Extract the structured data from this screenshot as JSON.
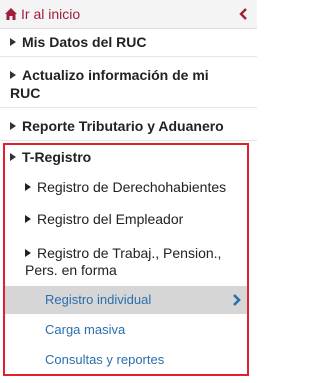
{
  "header": {
    "home_label": "Ir al inicio",
    "home_icon": "home-icon",
    "collapse_icon": "chevron-left-icon"
  },
  "menu": {
    "item_datos": "Mis Datos del RUC",
    "item_actualizo_line1": "Actualizo información de mi",
    "item_actualizo_line2": "RUC",
    "item_reporte": "Reporte Tributario y Aduanero",
    "item_tregistro": "T-Registro"
  },
  "tregistro": {
    "sub_derechohabientes": "Registro de Derechohabientes",
    "sub_empleador": "Registro del Empleador",
    "sub_trabaj_line1": "Registro de Trabaj., Pension.,",
    "sub_trabaj_line2": "Pers. en forma",
    "leaf_individual": "Registro individual",
    "leaf_masiva": "Carga masiva",
    "leaf_consultas": "Consultas y reportes"
  },
  "colors": {
    "brand": "#a01e3c",
    "link": "#2a6fad",
    "highlight_border": "#e0202a",
    "active_bg": "#d6d6d6"
  }
}
